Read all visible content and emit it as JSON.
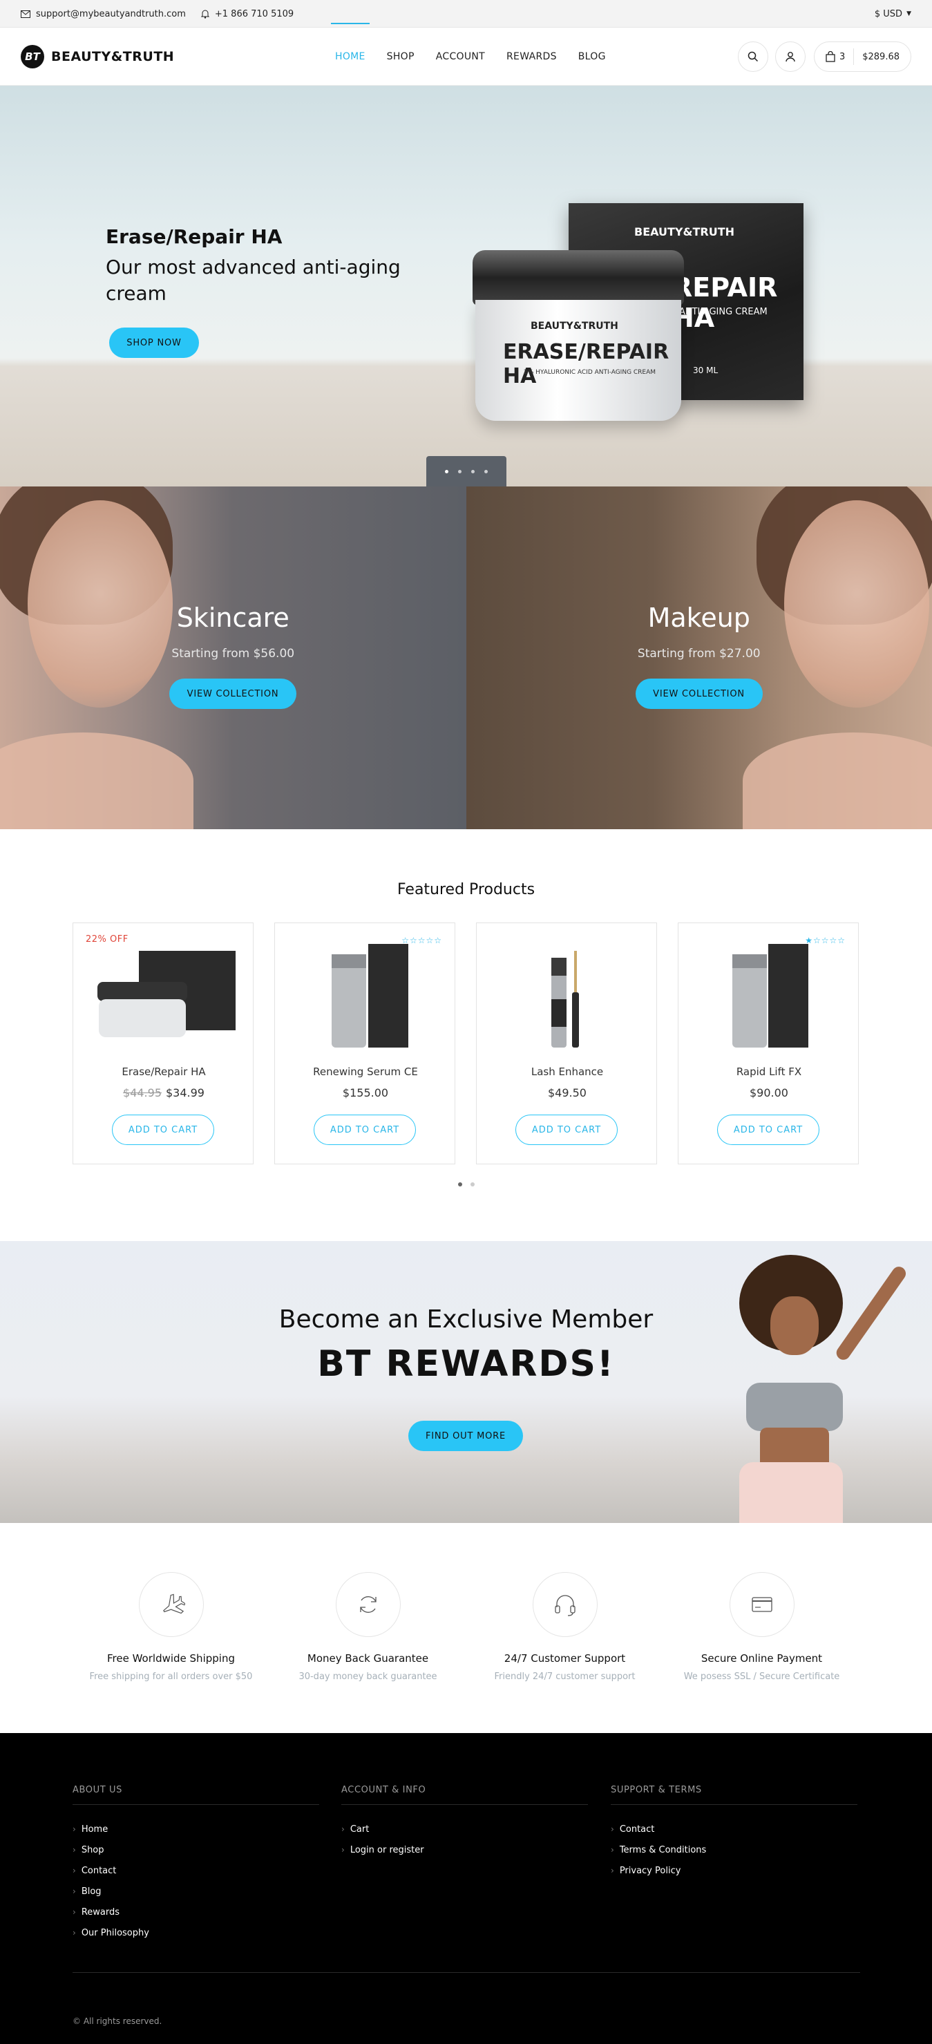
{
  "topbar": {
    "email": "support@mybeautyandtruth.com",
    "phone": "+1 866 710 5109",
    "currency": "$ USD"
  },
  "header": {
    "logo_mark": "BT",
    "logo_text": "BEAUTY&TRUTH",
    "nav": [
      {
        "label": "HOME",
        "active": true
      },
      {
        "label": "SHOP",
        "active": false
      },
      {
        "label": "ACCOUNT",
        "active": false
      },
      {
        "label": "REWARDS",
        "active": false
      },
      {
        "label": "BLOG",
        "active": false
      }
    ],
    "cart_count": "3",
    "cart_total": "$289.68"
  },
  "hero": {
    "title": "Erase/Repair HA",
    "subtitle": "Our most advanced anti-aging cream",
    "button": "SHOP NOW",
    "box_brand": "BEAUTY&TRUTH",
    "box_name": "REPAIR HA",
    "box_sub": "ANTI-AGING CREAM",
    "box_volume": "30 ML",
    "jar_brand": "BEAUTY&TRUTH",
    "jar_name": "ERASE/REPAIR HA",
    "jar_sub": "2% HYALURONIC ACID ANTI-AGING CREAM",
    "slides": 4,
    "active_slide": 1
  },
  "collections": [
    {
      "title": "Skincare",
      "subtitle": "Starting from $56.00",
      "button": "VIEW COLLECTION"
    },
    {
      "title": "Makeup",
      "subtitle": "Starting from $27.00",
      "button": "VIEW COLLECTION"
    }
  ],
  "featured": {
    "title": "Featured Products",
    "products": [
      {
        "name": "Erase/Repair HA",
        "old_price": "$44.95",
        "price": "$34.99",
        "badge": "22% OFF",
        "stars": "",
        "button": "ADD TO CART"
      },
      {
        "name": "Renewing Serum CE",
        "old_price": "",
        "price": "$155.00",
        "badge": "",
        "stars": "☆☆☆☆☆",
        "button": "ADD TO CART"
      },
      {
        "name": "Lash Enhance",
        "old_price": "",
        "price": "$49.50",
        "badge": "",
        "stars": "",
        "button": "ADD TO CART"
      },
      {
        "name": "Rapid Lift FX",
        "old_price": "",
        "price": "$90.00",
        "badge": "",
        "stars": "★☆☆☆☆",
        "button": "ADD TO CART"
      }
    ]
  },
  "rewards": {
    "subtitle": "Become an Exclusive Member",
    "title": "BT REWARDS!",
    "button": "FIND OUT MORE"
  },
  "features": [
    {
      "icon": "airplane-icon",
      "title": "Free Worldwide Shipping",
      "subtitle": "Free shipping for all orders over $50"
    },
    {
      "icon": "refresh-icon",
      "title": "Money Back Guarantee",
      "subtitle": "30-day money back guarantee"
    },
    {
      "icon": "headset-icon",
      "title": "24/7 Customer Support",
      "subtitle": "Friendly 24/7 customer support"
    },
    {
      "icon": "credit-card-icon",
      "title": "Secure Online Payment",
      "subtitle": "We posess SSL / Secure Certificate"
    }
  ],
  "footer": {
    "columns": [
      {
        "heading": "ABOUT US",
        "links": [
          "Home",
          "Shop",
          "Contact",
          "Blog",
          "Rewards",
          "Our Philosophy"
        ]
      },
      {
        "heading": "ACCOUNT & INFO",
        "links": [
          "Cart",
          "Login or register"
        ]
      },
      {
        "heading": "SUPPORT & TERMS",
        "links": [
          "Contact",
          "Terms & Conditions",
          "Privacy Policy"
        ]
      }
    ],
    "copyright": "© All rights reserved."
  },
  "colors": {
    "accent": "#29c5f6",
    "accent_text": "#29b6e8",
    "sale": "#e0463a",
    "footer_bg": "#000000"
  }
}
